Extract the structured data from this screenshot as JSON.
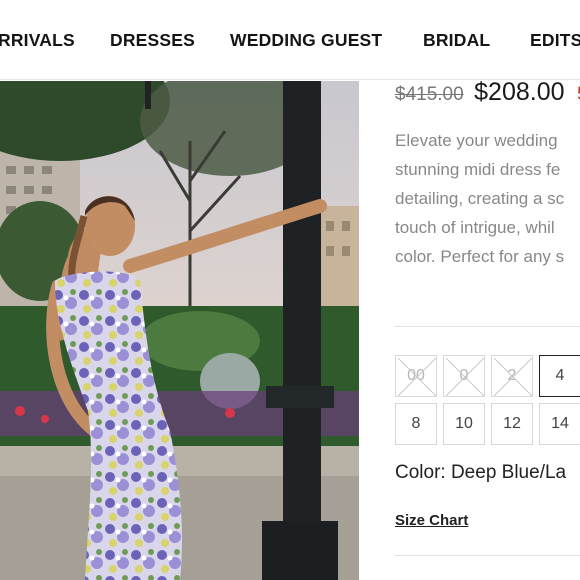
{
  "nav": {
    "items": [
      {
        "label": "RRIVALS"
      },
      {
        "label": "DRESSES"
      },
      {
        "label": "WEDDING GUEST"
      },
      {
        "label": "BRIDAL"
      },
      {
        "label": "EDITS"
      }
    ]
  },
  "product": {
    "image_icon": "product-photo",
    "price": {
      "original": "$415.00",
      "sale": "$208.00",
      "discount_fragment": "5"
    },
    "description_lines": [
      "Elevate your wedding",
      "stunning midi dress fe",
      "detailing, creating a sc",
      "touch of intrigue, whil",
      "color. Perfect for any s"
    ],
    "sizes": [
      {
        "label": "00",
        "available": false,
        "selected": false
      },
      {
        "label": "0",
        "available": false,
        "selected": false
      },
      {
        "label": "2",
        "available": false,
        "selected": false
      },
      {
        "label": "4",
        "available": true,
        "selected": true
      },
      {
        "label": "8",
        "available": true,
        "selected": false
      },
      {
        "label": "10",
        "available": true,
        "selected": false
      },
      {
        "label": "12",
        "available": true,
        "selected": false
      },
      {
        "label": "14",
        "available": true,
        "selected": false
      }
    ],
    "color_label": "Color: Deep Blue/La",
    "size_chart_label": "Size Chart"
  },
  "colors": {
    "sale_accent": "#d23b2a",
    "muted_text": "#888888"
  }
}
